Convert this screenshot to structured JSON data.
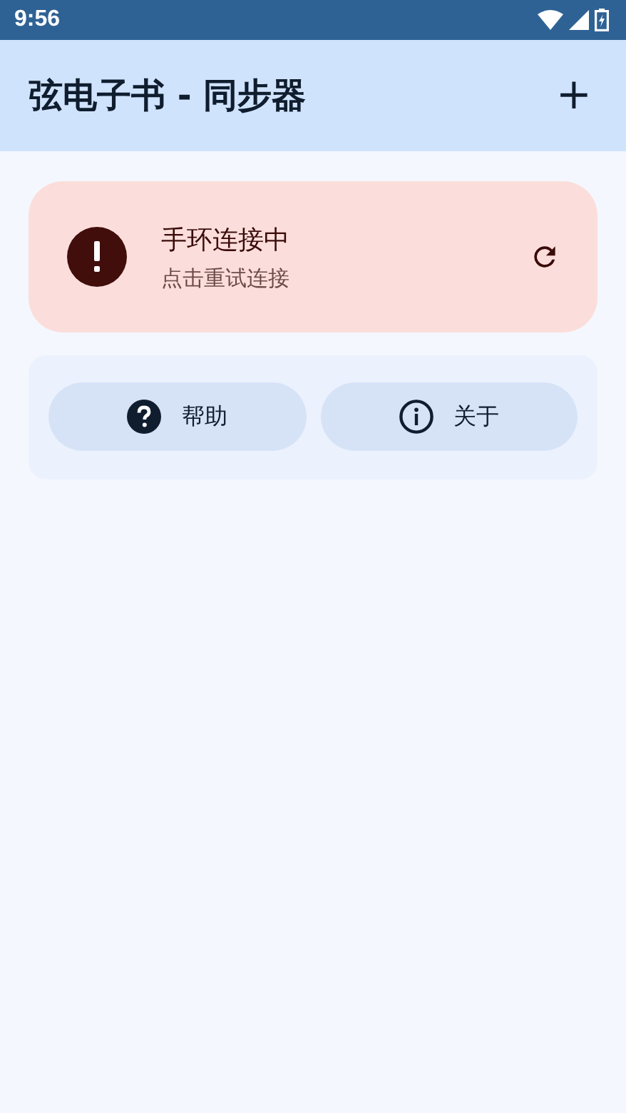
{
  "status_bar": {
    "time": "9:56"
  },
  "app_bar": {
    "title": "弦电子书 - 同步器",
    "action": "+"
  },
  "connection_card": {
    "title": "手环连接中",
    "subtitle": "点击重试连接"
  },
  "buttons": [
    {
      "kind": "help",
      "label": "帮助"
    },
    {
      "kind": "info",
      "label": "关于"
    }
  ]
}
